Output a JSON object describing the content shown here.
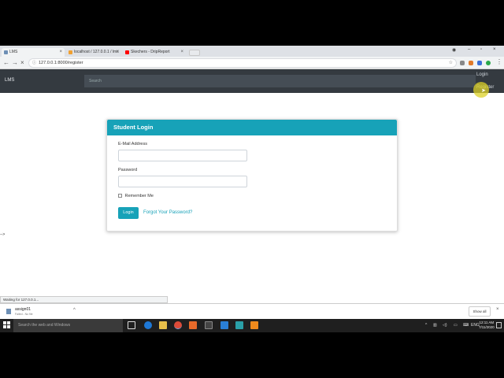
{
  "browser": {
    "tabs": [
      {
        "title": "LMS",
        "active": true,
        "favicon_color": "#6d8fb5"
      },
      {
        "title": "localhost / 127.0.0.1 / lms",
        "active": false,
        "favicon_color": "#f0a030"
      },
      {
        "title": "Skechers - DripReport",
        "active": false,
        "favicon_color": "#ff0000"
      }
    ],
    "address": "127.0.0.1:8000/register",
    "address_host": "127.0.0.1",
    "address_rest": ":8000/register"
  },
  "navbar": {
    "brand": "LMS",
    "search_placeholder": "Search",
    "login_link": "Login",
    "register_link": "Register"
  },
  "login_card": {
    "title": "Student Login",
    "email_label": "E-Mail Address",
    "email_value": "",
    "password_label": "Password",
    "password_value": "",
    "remember_label": "Remember Me",
    "remember_checked": false,
    "login_button": "Login",
    "forgot_link": "Forgot Your Password?"
  },
  "page": {
    "stray_text": "-->"
  },
  "status_bar": {
    "text": "Waiting for 127.0.0.1..."
  },
  "download_shelf": {
    "filename": "assign01",
    "status": "Failed - No file",
    "show_all": "Show all"
  },
  "taskbar": {
    "search_placeholder": "Search the web and Windows",
    "language": "ENG",
    "time": "12:11 AM",
    "date": "7/11/2020"
  },
  "colors": {
    "accent": "#17a2b8",
    "navbar": "#343a40"
  }
}
